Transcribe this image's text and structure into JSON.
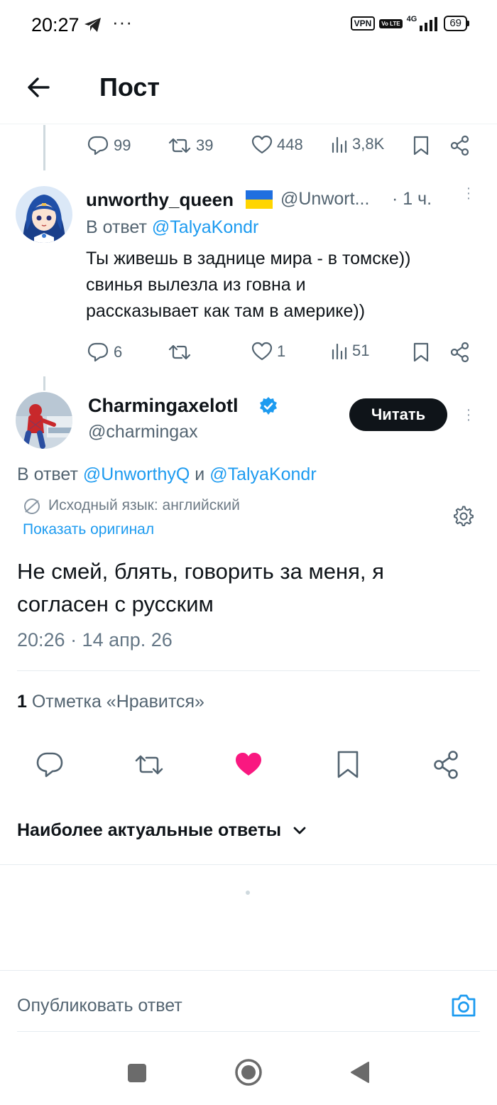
{
  "status_bar": {
    "time": "20:27",
    "dots": "···",
    "vpn": "VPN",
    "volte": "Vo LTE",
    "network": "4G",
    "battery": "69"
  },
  "header": {
    "title": "Пост"
  },
  "prev_tweet": {
    "replies": "99",
    "retweets": "39",
    "likes": "448",
    "views": "3,8K"
  },
  "reply1": {
    "name": "unworthy_queen",
    "handle": "@Unwort...",
    "time": "· 1 ч.",
    "reply_prefix": "В ответ",
    "reply_to": "@TalyaKondr",
    "text_lines": [
      "Ты живешь в заднице мира - в томске))",
      "свинья вылезла из говна и",
      "рассказывает как там в америке))"
    ],
    "replies": "6",
    "retweets": "",
    "likes": "1",
    "views": "51"
  },
  "main_tweet": {
    "name": "Charmingaxelotl",
    "handle": "@charmingax",
    "follow_label": "Читать",
    "reply_prefix": "В ответ",
    "reply_to_1": "@UnworthyQ",
    "reply_and": "и",
    "reply_to_2": "@TalyaKondr",
    "translation_note": "Исходный язык: английский",
    "show_original": "Показать оригинал",
    "text_lines": [
      "Не смей, блять, говорить за меня, я",
      "согласен с русским"
    ],
    "timestamp": "20:26 · 14 апр. 26",
    "like_count": "1",
    "like_label": "Отметка «Нравится»",
    "liked_color": "#f91880"
  },
  "sort": {
    "label": "Наиболее актуальные ответы"
  },
  "composer": {
    "placeholder": "Опубликовать ответ"
  },
  "colors": {
    "accent": "#1d9bf0",
    "muted": "#536471",
    "like": "#f91880",
    "verified": "#1d9bf0"
  }
}
